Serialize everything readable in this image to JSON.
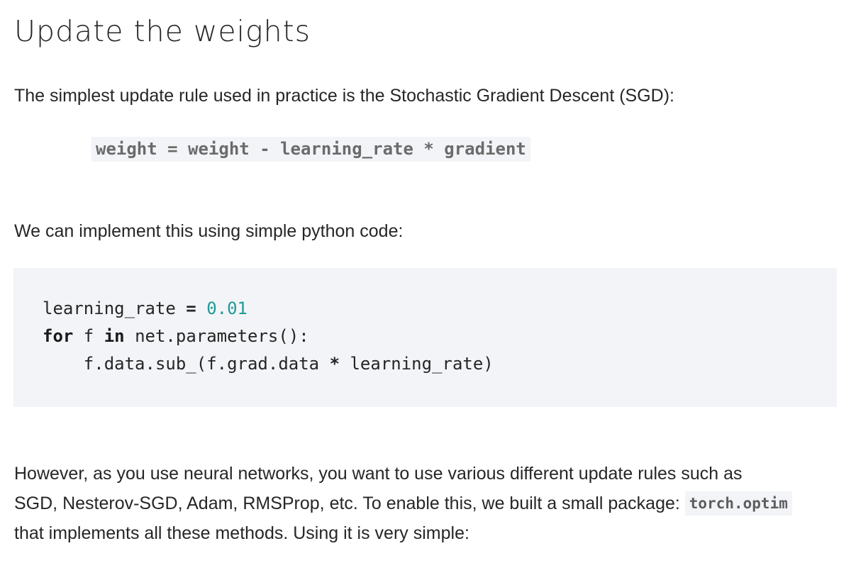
{
  "heading": "Update the weights",
  "intro": "The simplest update rule used in practice is the Stochastic Gradient Descent (SGD):",
  "formula": "weight = weight - learning_rate * gradient",
  "python_intro": "We can implement this using simple python code:",
  "code": {
    "line1": {
      "var": "learning_rate ",
      "op": "=",
      "space": " ",
      "value": "0.01"
    },
    "line2": {
      "kw_for": "for",
      "mid1": " f ",
      "kw_in": "in",
      "rest": " net.parameters():"
    },
    "line3": {
      "indent": "    ",
      "part1": "f.data.sub_(f.grad.data ",
      "op": "*",
      "part2": " learning_rate)"
    }
  },
  "outro": {
    "line1": "However, as you use neural networks, you want to use various different update rules such as",
    "line2_pre": "SGD, Nesterov-SGD, Adam, RMSProp, etc. To enable this, we built a small package: ",
    "package": "torch.optim",
    "line3": "that implements all these methods. Using it is very simple:"
  }
}
